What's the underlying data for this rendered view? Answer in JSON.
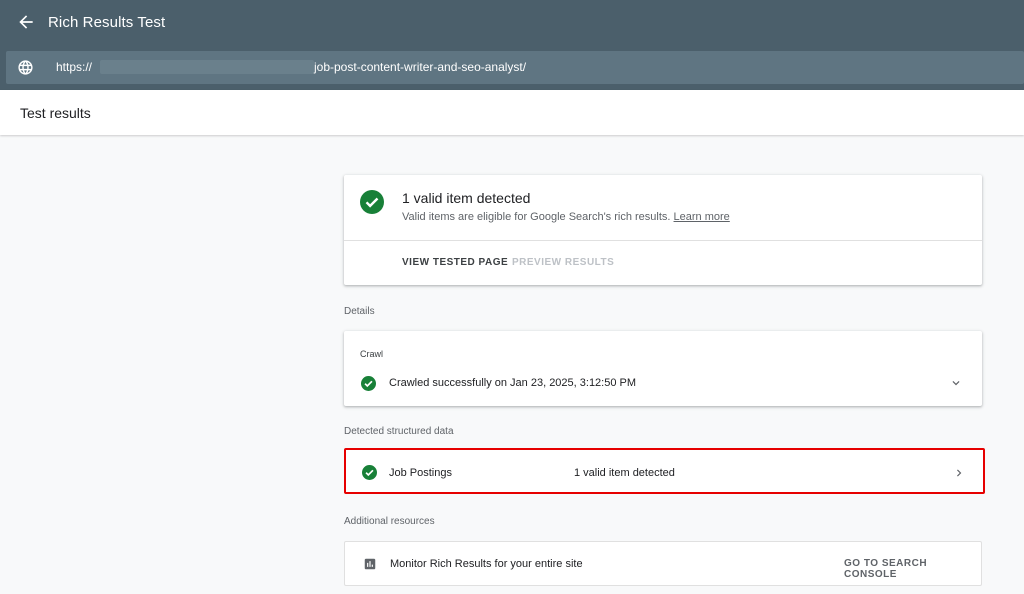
{
  "app": {
    "title": "Rich Results Test",
    "url_prefix": "https://",
    "url_suffix": "job-post-content-writer-and-seo-analyst/"
  },
  "page": {
    "subtitle": "Test results"
  },
  "summary": {
    "heading": "1 valid item detected",
    "description": "Valid items are eligible for Google Search's rich results.",
    "learn_more": "Learn more",
    "view_tested_page": "VIEW TESTED PAGE",
    "preview_results": "PREVIEW RESULTS"
  },
  "details": {
    "section_label": "Details",
    "crawl_label": "Crawl",
    "crawl_status": "Crawled successfully on Jan 23, 2025, 3:12:50 PM"
  },
  "structured_data": {
    "section_label": "Detected structured data",
    "items": [
      {
        "name": "Job Postings",
        "status": "1 valid item detected"
      }
    ]
  },
  "resources": {
    "section_label": "Additional resources",
    "monitor_text": "Monitor Rich Results for your entire site",
    "console_link": "GO TO SEARCH CONSOLE"
  },
  "colors": {
    "appbar": "#4b5f6b",
    "urlbar": "#5f7582",
    "success_green": "#188038",
    "highlight_red": "#e60000"
  },
  "icons": [
    "back-arrow-icon",
    "globe-icon",
    "check-circle-icon",
    "chevron-down-icon",
    "chevron-right-icon",
    "bar-chart-icon"
  ]
}
